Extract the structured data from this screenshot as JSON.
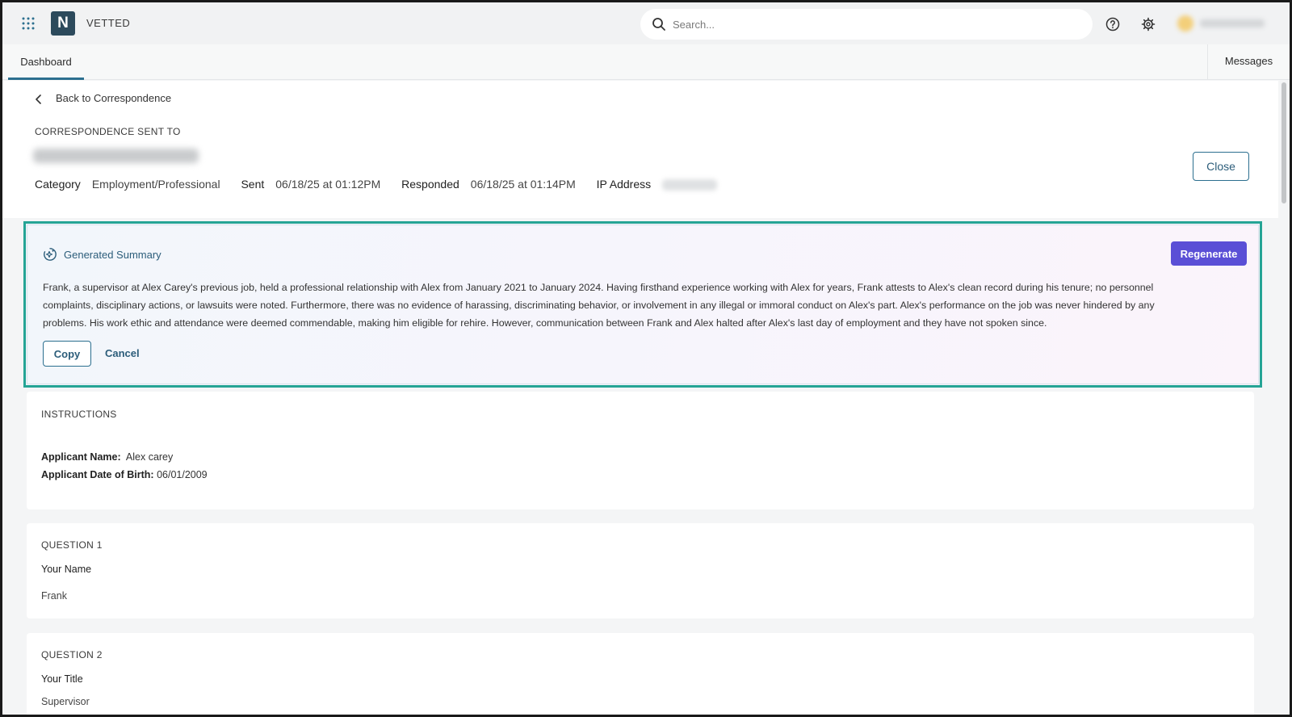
{
  "header": {
    "brand_letter": "N",
    "brand_name": "VETTED",
    "search_placeholder": "Search..."
  },
  "tabs": {
    "dashboard": "Dashboard",
    "messages": "Messages"
  },
  "correspondence": {
    "back_label": "Back to Correspondence",
    "sent_to_label": "CORRESPONDENCE SENT TO",
    "category_label": "Category",
    "category_value": "Employment/Professional",
    "sent_label": "Sent",
    "sent_value": "06/18/25 at 01:12PM",
    "responded_label": "Responded",
    "responded_value": "06/18/25 at 01:14PM",
    "ip_label": "IP Address",
    "close_label": "Close"
  },
  "summary": {
    "title": "Generated Summary",
    "regenerate_label": "Regenerate",
    "text": "Frank, a supervisor at Alex Carey's previous job, held a professional relationship with Alex from January 2021 to January 2024. Having firsthand experience working with Alex for years, Frank attests to Alex's clean record during his tenure; no personnel complaints, disciplinary actions, or lawsuits were noted. Furthermore, there was no evidence of harassing, discriminating behavior, or involvement in any illegal or immoral conduct on Alex's part. Alex's performance on the job was never hindered by any problems. His work ethic and attendance were deemed commendable, making him eligible for rehire. However, communication between Frank and Alex halted after Alex's last day of employment and they have not spoken since.",
    "copy_label": "Copy",
    "cancel_label": "Cancel"
  },
  "instructions": {
    "label": "INSTRUCTIONS",
    "applicant_name_label": "Applicant Name:",
    "applicant_name_value": "Alex carey",
    "dob_label": "Applicant Date of Birth:",
    "dob_value": "06/01/2009"
  },
  "questions": [
    {
      "label": "QUESTION 1",
      "title": "Your Name",
      "answer": "Frank"
    },
    {
      "label": "QUESTION 2",
      "title": "Your Title",
      "answer": "Supervisor"
    }
  ],
  "colors": {
    "accent": "#2c6f8f",
    "regenerate": "#5a4fd6",
    "highlight_border": "#25a495",
    "logo_bg": "#2c4a5c"
  },
  "icons": [
    "apps-grid-icon",
    "search-icon",
    "help-icon",
    "gear-icon",
    "chevron-left-icon",
    "sparkle-icon"
  ]
}
